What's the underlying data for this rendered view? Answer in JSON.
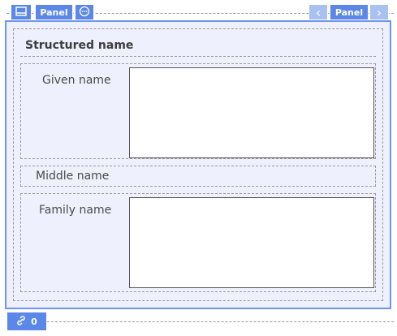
{
  "toolbar": {
    "panel_label_left": "Panel",
    "panel_label_right": "Panel",
    "prev_glyph": "‹",
    "next_glyph": "›"
  },
  "panel": {
    "title": "Structured name",
    "fields": [
      {
        "label": "Given name",
        "value": ""
      },
      {
        "label": "Middle name"
      },
      {
        "label": "Family name",
        "value": ""
      }
    ]
  },
  "footer": {
    "link_count": "0"
  },
  "icons": {
    "layout": "panel-layout-icon",
    "more": "more-options-icon",
    "link": "link-icon",
    "prev": "chevron-left-icon",
    "next": "chevron-right-icon"
  },
  "colors": {
    "accent": "#5b87e8",
    "accent_light": "#a8c0f2",
    "panel_bg": "#eef1fd",
    "panel_border": "#6f96ee"
  }
}
